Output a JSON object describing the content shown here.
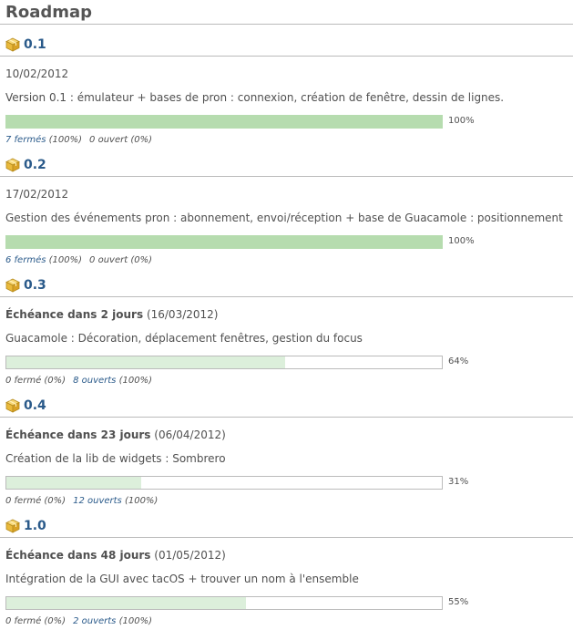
{
  "page": {
    "title": "Roadmap"
  },
  "colors": {
    "done_fill": "#b6dcaf",
    "partial_fill": "#dcefdb",
    "link": "#2a5a8a"
  },
  "versions": [
    {
      "name": "0.1",
      "date_prefix": "",
      "date_text": "10/02/2012",
      "description": "Version 0.1 : émulateur + bases de pron : connexion, création de fenêtre, dessin de lignes.",
      "progress": 1.0,
      "percent_label": "100%",
      "closed_label": "7 fermés",
      "closed_pct": "(100%)",
      "open_label": "0 ouvert",
      "open_pct": "(0%)",
      "closed_link": true,
      "open_link": false
    },
    {
      "name": "0.2",
      "date_prefix": "",
      "date_text": "17/02/2012",
      "description": "Gestion des événements pron : abonnement, envoi/réception + base de Guacamole : positionnement",
      "progress": 1.0,
      "percent_label": "100%",
      "closed_label": "6 fermés",
      "closed_pct": "(100%)",
      "open_label": "0 ouvert",
      "open_pct": "(0%)",
      "closed_link": true,
      "open_link": false
    },
    {
      "name": "0.3",
      "date_prefix": "Échéance dans 2 jours",
      "date_text": "(16/03/2012)",
      "description": "Guacamole : Décoration, déplacement fenêtres, gestion du focus",
      "progress": 0.64,
      "percent_label": "64%",
      "closed_label": "0 fermé",
      "closed_pct": "(0%)",
      "open_label": "8 ouverts",
      "open_pct": "(100%)",
      "closed_link": false,
      "open_link": true
    },
    {
      "name": "0.4",
      "date_prefix": "Échéance dans 23 jours",
      "date_text": "(06/04/2012)",
      "description": "Création de la lib de widgets : Sombrero",
      "progress": 0.31,
      "percent_label": "31%",
      "closed_label": "0 fermé",
      "closed_pct": "(0%)",
      "open_label": "12 ouverts",
      "open_pct": "(100%)",
      "closed_link": false,
      "open_link": true
    },
    {
      "name": "1.0",
      "date_prefix": "Échéance dans 48 jours",
      "date_text": "(01/05/2012)",
      "description": "Intégration de la GUI avec tacOS + trouver un nom à l'ensemble",
      "progress": 0.55,
      "percent_label": "55%",
      "closed_label": "0 fermé",
      "closed_pct": "(0%)",
      "open_label": "2 ouverts",
      "open_pct": "(100%)",
      "closed_link": false,
      "open_link": true
    }
  ]
}
